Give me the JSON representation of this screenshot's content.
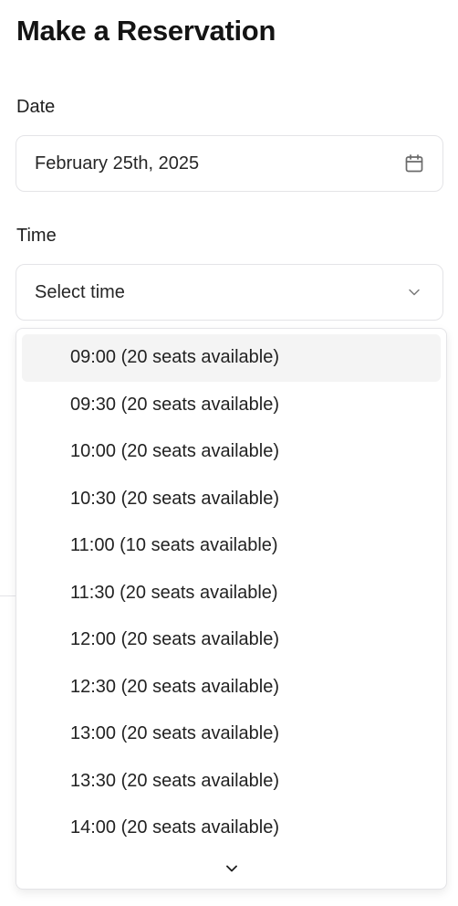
{
  "header": {
    "title": "Make a Reservation"
  },
  "date": {
    "label": "Date",
    "value": "February 25th, 2025",
    "icon": "calendar-icon"
  },
  "time": {
    "label": "Time",
    "placeholder": "Select time",
    "icon": "chevron-down-icon"
  },
  "time_options": [
    "09:00 (20 seats available)",
    "09:30 (20 seats available)",
    "10:00 (20 seats available)",
    "10:30 (20 seats available)",
    "11:00 (10 seats available)",
    "11:30 (20 seats available)",
    "12:00 (20 seats available)",
    "12:30 (20 seats available)",
    "13:00 (20 seats available)",
    "13:30 (20 seats available)",
    "14:00 (20 seats available)"
  ],
  "highlighted_option": "09:00 (20 seats available)",
  "colors": {
    "border": "#e4e4e7",
    "highlight": "#f4f4f4",
    "text": "#1b1b1b"
  }
}
